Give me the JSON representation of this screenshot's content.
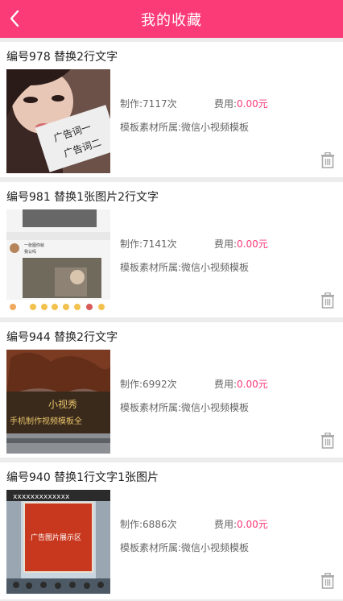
{
  "header": {
    "title": "我的收藏",
    "back_icon": "chevron-left-icon"
  },
  "colors": {
    "accent": "#fb3a78",
    "price": "#fb3a78"
  },
  "items": [
    {
      "title": "编号978  替换2行文字",
      "made": "制作:7117次",
      "fee_label": "费用:",
      "fee_value": "0.00元",
      "category": "模板素材所属:微信小视频模板",
      "thumb_text_1": "广告词一",
      "thumb_text_2": "广告词二"
    },
    {
      "title": "编号981  替换1张图片2行文字",
      "made": "制作:7141次",
      "fee_label": "费用:",
      "fee_value": "0.00元",
      "category": "模板素材所属:微信小视频模板",
      "thumb_text_1": "一张图你就",
      "thumb_text_2": "我认吗"
    },
    {
      "title": "编号944  替换2行文字",
      "made": "制作:6992次",
      "fee_label": "费用:",
      "fee_value": "0.00元",
      "category": "模板素材所属:微信小视频模板",
      "thumb_text_1": "小视秀",
      "thumb_text_2": "手机制作视频模板全"
    },
    {
      "title": "编号940  替换1行文字1张图片",
      "made": "制作:6886次",
      "fee_label": "费用:",
      "fee_value": "0.00元",
      "category": "模板素材所属:微信小视频模板",
      "thumb_text_1": "广告图片展示区",
      "thumb_text_2": "xxxxxxxxxxxxx"
    }
  ]
}
